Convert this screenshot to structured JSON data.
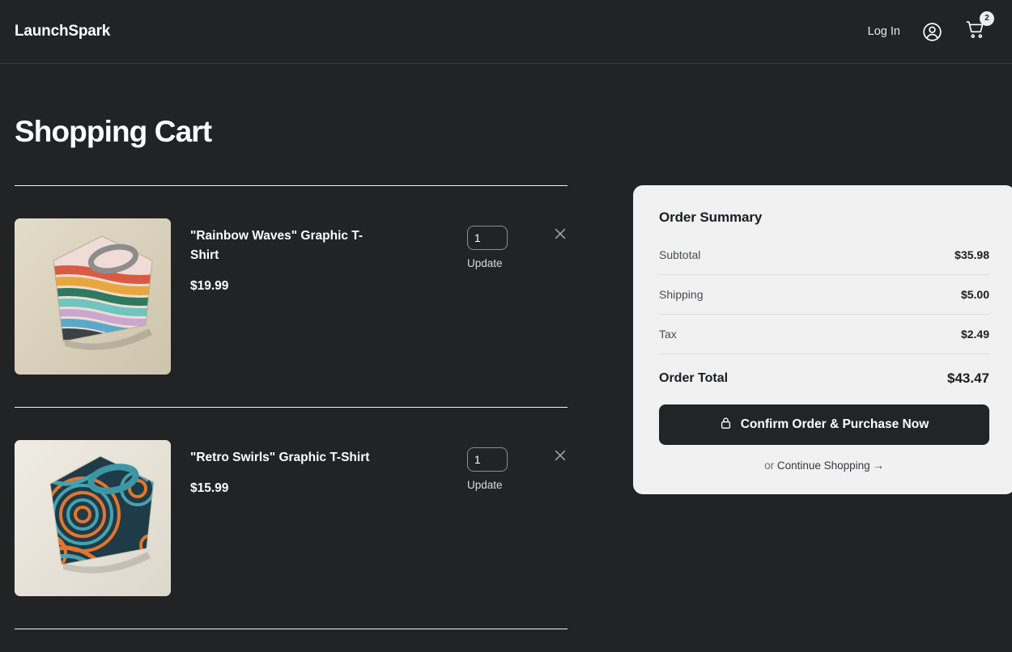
{
  "header": {
    "brand": "LaunchSpark",
    "login_label": "Log In",
    "account_icon": "user-circle-icon",
    "cart_icon": "shopping-cart-icon",
    "cart_badge_count": "2"
  },
  "page": {
    "title": "Shopping Cart"
  },
  "cart": {
    "items": [
      {
        "name": "\"Rainbow Waves\" Graphic T-Shirt",
        "price": "$19.99",
        "quantity": "1",
        "update_label": "Update",
        "remove_icon": "close-icon",
        "image_alt": "rainbow-waves-tshirt-thumbnail"
      },
      {
        "name": "\"Retro Swirls\" Graphic T-Shirt",
        "price": "$15.99",
        "quantity": "1",
        "update_label": "Update",
        "remove_icon": "close-icon",
        "image_alt": "retro-swirls-tshirt-thumbnail"
      }
    ]
  },
  "summary": {
    "title": "Order Summary",
    "rows": [
      {
        "label": "Subtotal",
        "value": "$35.98"
      },
      {
        "label": "Shipping",
        "value": "$5.00"
      },
      {
        "label": "Tax",
        "value": "$2.49"
      }
    ],
    "total_label": "Order Total",
    "total_value": "$43.47",
    "confirm_label": "Confirm Order & Purchase Now",
    "confirm_icon": "lock-icon",
    "continue_prefix": "or ",
    "continue_label": "Continue Shopping →"
  },
  "colors": {
    "page_background": "#222325",
    "card_background": "#f1f1f1",
    "text_primary": "#ffffff",
    "button_background": "#232427",
    "divider": "#f2f2f2"
  }
}
